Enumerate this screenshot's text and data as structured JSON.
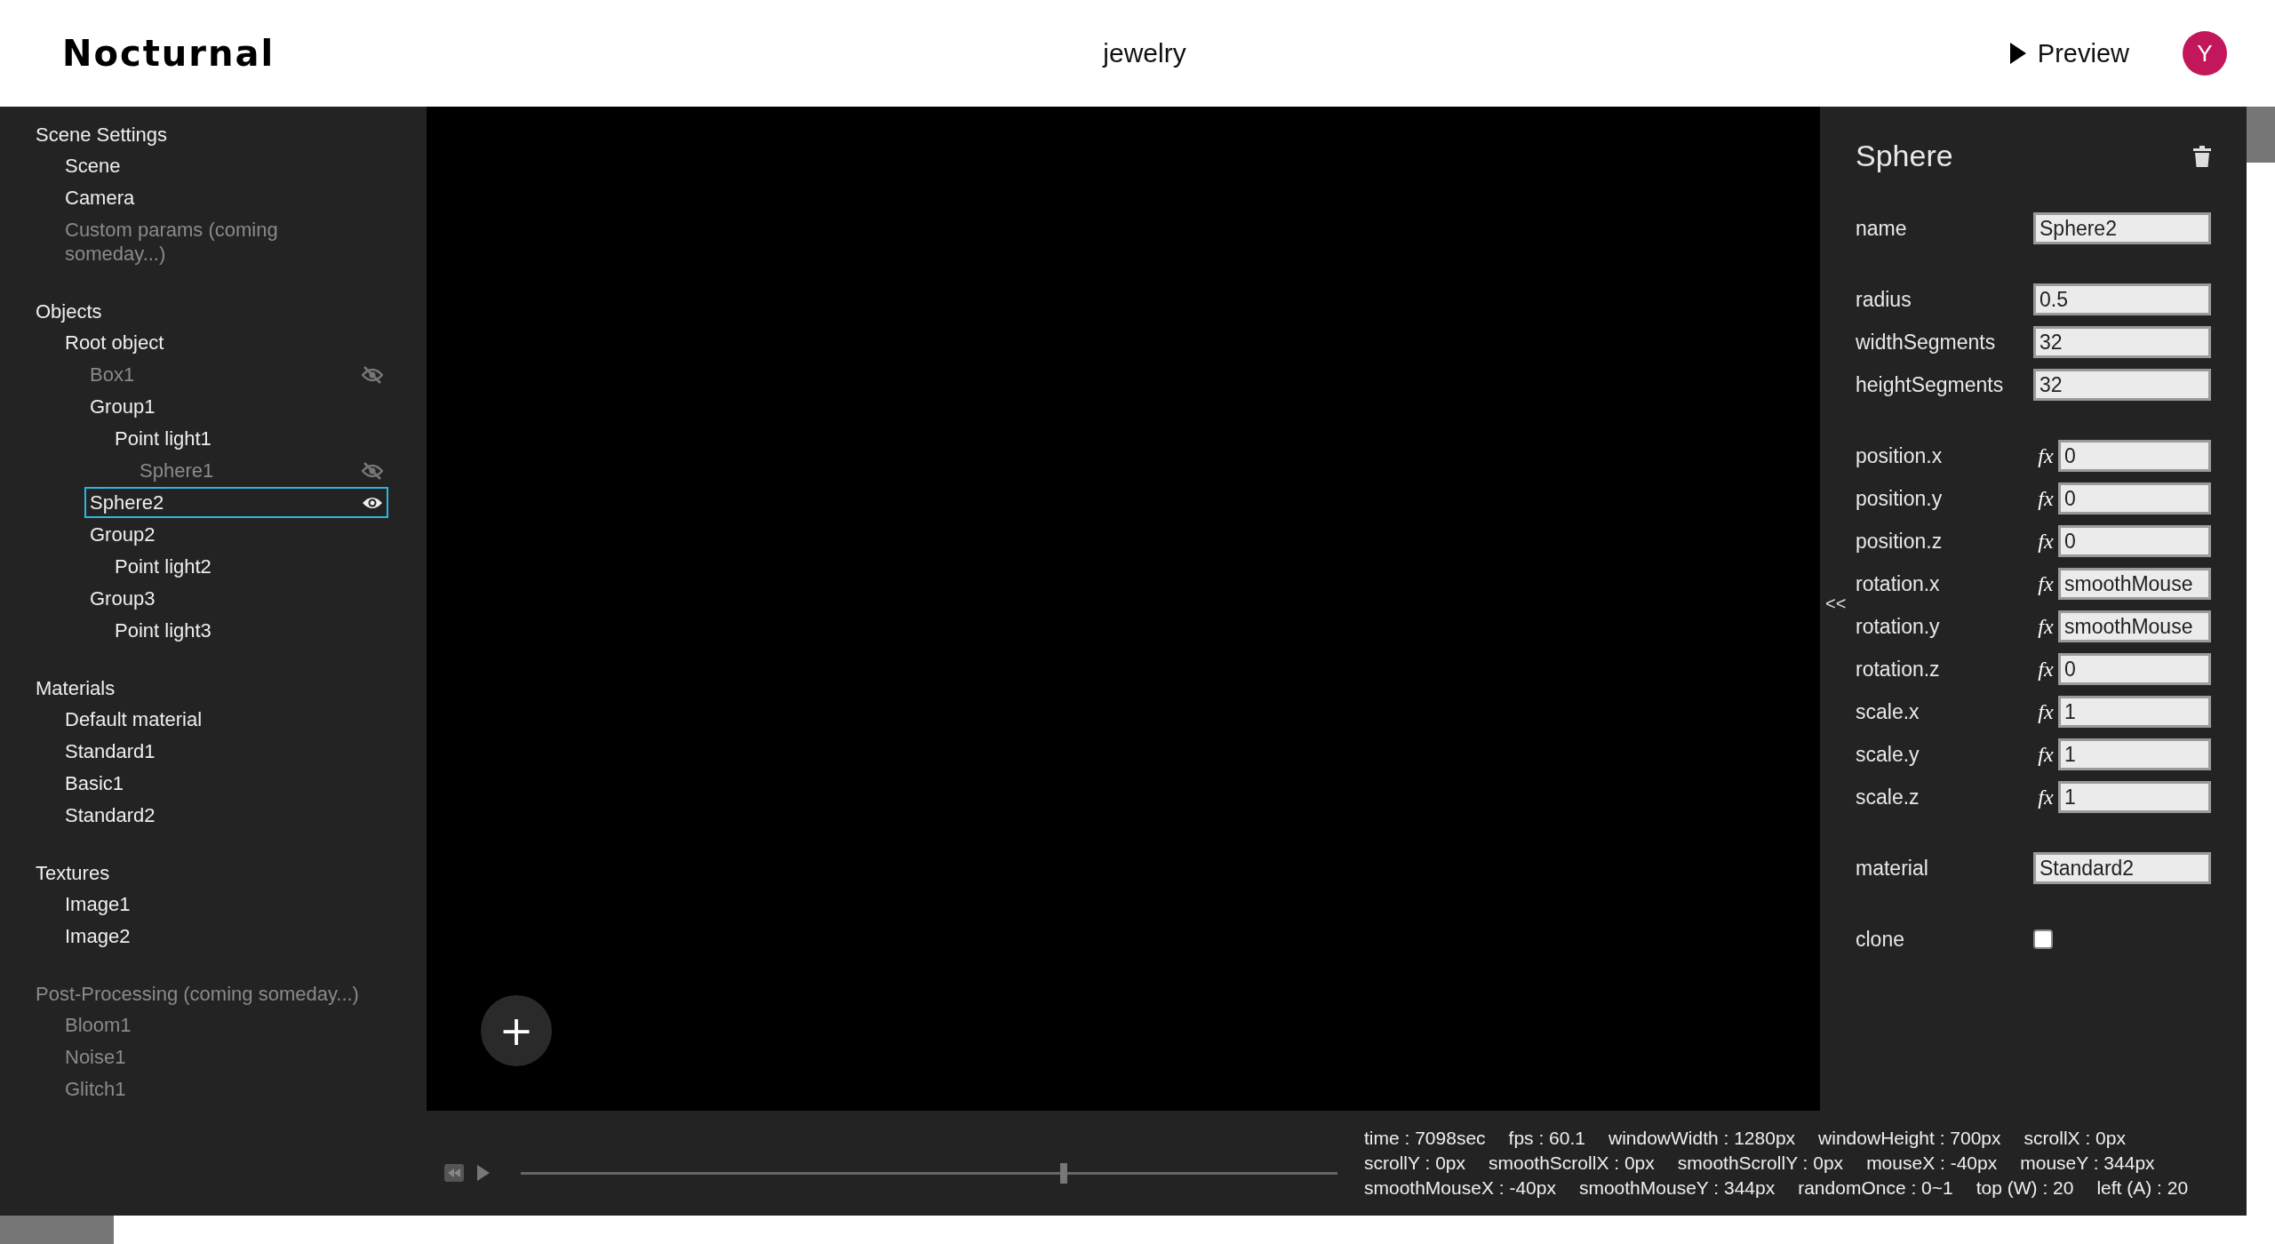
{
  "header": {
    "logo": "Nocturnal",
    "project": "jewelry",
    "preview": "Preview",
    "avatar": "Y"
  },
  "sidebar": [
    {
      "title": "Scene Settings",
      "disabled": false,
      "items": [
        {
          "label": "Scene",
          "disabled": false,
          "selected": false
        },
        {
          "label": "Camera",
          "disabled": false,
          "selected": false
        },
        {
          "label": "Custom params (coming someday...)",
          "disabled": true,
          "selected": false
        }
      ]
    },
    {
      "title": "Objects",
      "disabled": false,
      "items": [
        {
          "label": "Root object",
          "selected": false,
          "children": [
            {
              "label": "Box1",
              "visible": false,
              "selected": false
            },
            {
              "label": "Group1",
              "selected": false,
              "children": [
                {
                  "label": "Point light1",
                  "selected": false,
                  "children": [
                    {
                      "label": "Sphere1",
                      "visible": false,
                      "selected": false
                    }
                  ]
                }
              ]
            },
            {
              "label": "Sphere2",
              "visible": true,
              "selected": true
            },
            {
              "label": "Group2",
              "selected": false,
              "children": [
                {
                  "label": "Point light2",
                  "selected": false
                }
              ]
            },
            {
              "label": "Group3",
              "selected": false,
              "children": [
                {
                  "label": "Point light3",
                  "selected": false
                }
              ]
            }
          ]
        }
      ]
    },
    {
      "title": "Materials",
      "disabled": false,
      "items": [
        {
          "label": "Default material",
          "disabled": false,
          "selected": false
        },
        {
          "label": "Standard1",
          "disabled": false,
          "selected": false
        },
        {
          "label": "Basic1",
          "disabled": false,
          "selected": false
        },
        {
          "label": "Standard2",
          "disabled": false,
          "selected": false
        }
      ]
    },
    {
      "title": "Textures",
      "disabled": false,
      "items": [
        {
          "label": "Image1",
          "disabled": false,
          "selected": false
        },
        {
          "label": "Image2",
          "disabled": false,
          "selected": false
        }
      ]
    },
    {
      "title": "Post-Processing (coming someday...)",
      "disabled": true,
      "items": [
        {
          "label": "Bloom1",
          "disabled": true,
          "selected": false
        },
        {
          "label": "Noise1",
          "disabled": true,
          "selected": false
        },
        {
          "label": "Glitch1",
          "disabled": true,
          "selected": false
        }
      ]
    }
  ],
  "properties": {
    "title": "Sphere",
    "collapse": "<<",
    "groups": [
      [
        {
          "label": "name",
          "kind": "text",
          "value": "Sphere2"
        }
      ],
      [
        {
          "label": "radius",
          "kind": "text",
          "value": "0.5"
        },
        {
          "label": "widthSegments",
          "kind": "text",
          "value": "32"
        },
        {
          "label": "heightSegments",
          "kind": "text",
          "value": "32"
        }
      ],
      [
        {
          "label": "position.x",
          "kind": "fx",
          "fx": "fx",
          "value": "0"
        },
        {
          "label": "position.y",
          "kind": "fx",
          "fx": "fx",
          "value": "0"
        },
        {
          "label": "position.z",
          "kind": "fx",
          "fx": "fx",
          "value": "0"
        },
        {
          "label": "rotation.x",
          "kind": "fx",
          "fx": "fx",
          "value": "smoothMouse"
        },
        {
          "label": "rotation.y",
          "kind": "fx",
          "fx": "fx",
          "value": "smoothMouse"
        },
        {
          "label": "rotation.z",
          "kind": "fx",
          "fx": "fx",
          "value": "0"
        },
        {
          "label": "scale.x",
          "kind": "fx",
          "fx": "fx",
          "value": "1"
        },
        {
          "label": "scale.y",
          "kind": "fx",
          "fx": "fx",
          "value": "1"
        },
        {
          "label": "scale.z",
          "kind": "fx",
          "fx": "fx",
          "value": "1"
        }
      ],
      [
        {
          "label": "material",
          "kind": "text",
          "value": "Standard2"
        }
      ],
      [
        {
          "label": "clone",
          "kind": "checkbox",
          "checked": false
        }
      ]
    ]
  },
  "canvas": {
    "add": "+"
  },
  "timeline": {
    "level": 0.665,
    "stats": [
      "time : 7098sec",
      "fps : 60.1",
      "windowWidth : 1280px",
      "windowHeight : 700px",
      "scrollX : 0px",
      "scrollY : 0px",
      "smoothScrollX : 0px",
      "smoothScrollY : 0px",
      "mouseX : -40px",
      "mouseY : 344px",
      "smoothMouseX : -40px",
      "smoothMouseY : 344px",
      "randomOnce : 0~1",
      "top (W) : 20",
      "left (A) : 20"
    ]
  }
}
